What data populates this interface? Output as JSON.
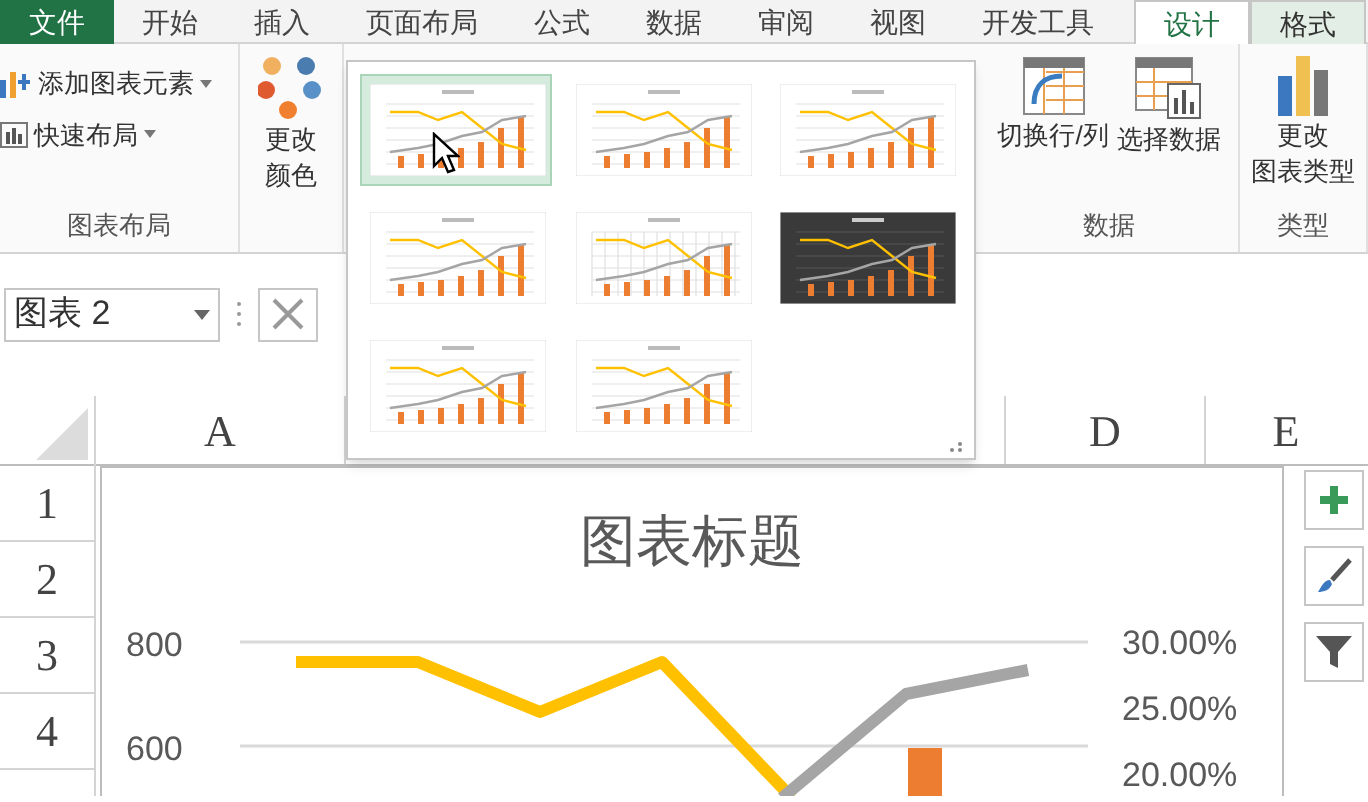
{
  "ribbon_tabs": [
    {
      "label": "文件",
      "kind": "file",
      "selected": false
    },
    {
      "label": "开始",
      "kind": "tab",
      "selected": false
    },
    {
      "label": "插入",
      "kind": "tab",
      "selected": false
    },
    {
      "label": "页面布局",
      "kind": "tab",
      "selected": false
    },
    {
      "label": "公式",
      "kind": "tab",
      "selected": false
    },
    {
      "label": "数据",
      "kind": "tab",
      "selected": false
    },
    {
      "label": "审阅",
      "kind": "tab",
      "selected": false
    },
    {
      "label": "视图",
      "kind": "tab",
      "selected": false
    },
    {
      "label": "开发工具",
      "kind": "tab",
      "selected": false
    },
    {
      "label": "设计",
      "kind": "context",
      "selected": true
    },
    {
      "label": "格式",
      "kind": "context",
      "selected": false
    }
  ],
  "ribbon_groups": [
    {
      "label": "图表布局",
      "commands": [
        {
          "lines": [
            "添加图表元素"
          ],
          "kind": "add-element"
        },
        {
          "lines": [
            "快速布局"
          ],
          "kind": "quick-layout"
        }
      ]
    },
    {
      "commands": [
        {
          "lines": [
            "更改",
            "颜色"
          ],
          "kind": "colors"
        }
      ]
    },
    {
      "label": "数据",
      "commands": [
        {
          "lines": [
            "切换行/列"
          ],
          "kind": "switch"
        },
        {
          "lines": [
            "选择数据"
          ],
          "kind": "select-data"
        }
      ]
    },
    {
      "label": "类型",
      "commands": [
        {
          "lines": [
            "更改",
            "图表类型"
          ],
          "kind": "change-type"
        }
      ]
    }
  ],
  "chart_styles": [
    {
      "kind": "light",
      "selected": true
    },
    {
      "kind": "light",
      "selected": false
    },
    {
      "kind": "light",
      "selected": false
    },
    {
      "kind": "light",
      "selected": false
    },
    {
      "kind": "grid",
      "selected": false
    },
    {
      "kind": "dark",
      "selected": false
    },
    {
      "kind": "light",
      "selected": false
    },
    {
      "kind": "light",
      "selected": false
    }
  ],
  "name_box": {
    "value": "图表 2"
  },
  "columns": [
    "A",
    "D",
    "E"
  ],
  "rows": [
    "1",
    "2",
    "3",
    "4"
  ],
  "chart": {
    "title": "图表标题",
    "left_axis_labels": [
      "800",
      "600"
    ],
    "right_axis_labels": [
      "30.00%",
      "25.00%",
      "20.00%"
    ]
  }
}
